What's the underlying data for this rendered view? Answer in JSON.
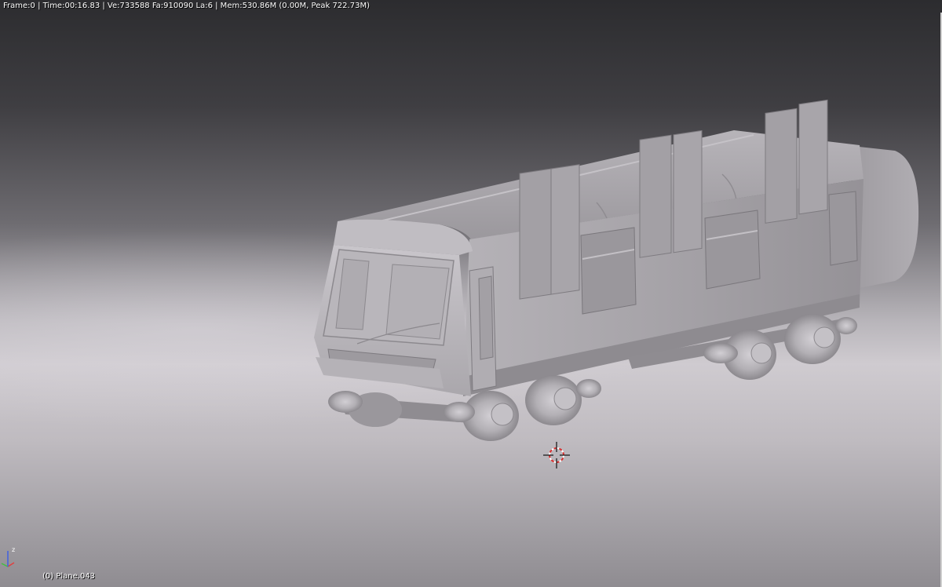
{
  "header": {
    "stats_text": "Frame:0 | Time:00:16.83 | Ve:733588 Fa:910090 La:6 | Mem:530.86M (0.00M, Peak 722.73M)"
  },
  "viewport": {
    "active_object_label": "(0) Plane.043",
    "axis_z_label": "z"
  },
  "colors": {
    "model_base": "#a9a6ab",
    "model_light": "#cfccd1",
    "model_dark": "#7e7b80",
    "cursor_red": "#d83030"
  },
  "icons": {
    "cursor": "3d-cursor-icon",
    "axis": "axis-gizmo-icon"
  }
}
